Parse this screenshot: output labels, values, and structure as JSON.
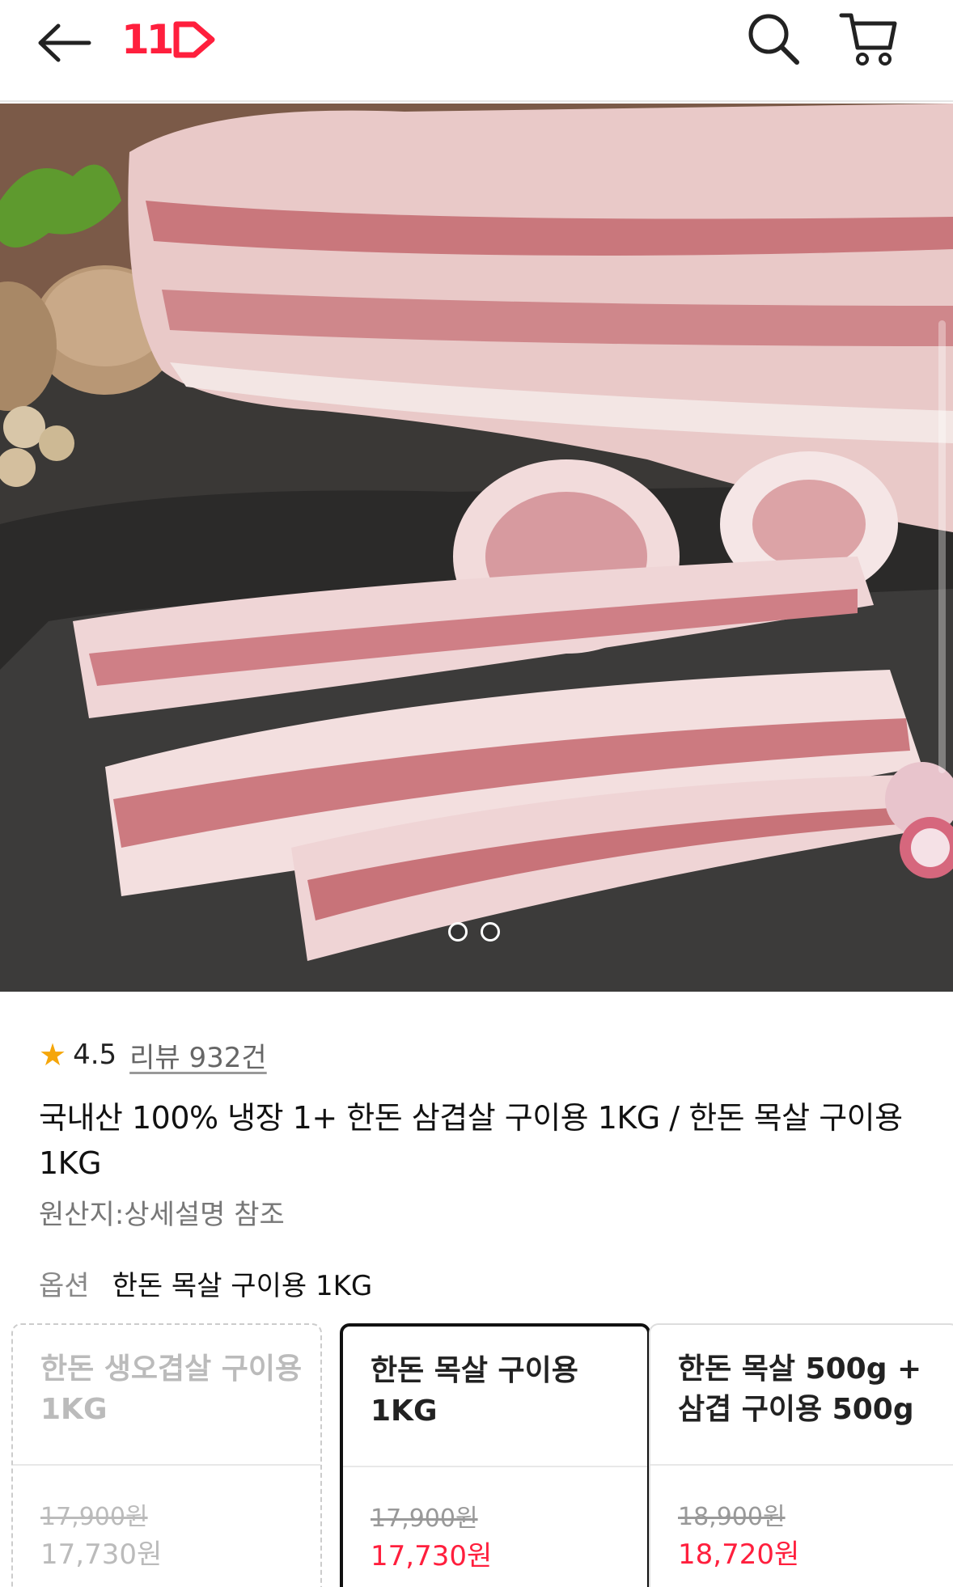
{
  "header": {
    "logo_text": "11",
    "brand_color": "#ff1f3d",
    "icons": [
      "back-arrow-icon",
      "search-icon",
      "cart-icon"
    ]
  },
  "gallery": {
    "total_images": 2,
    "current_index": 1
  },
  "product": {
    "rating": "4.5",
    "review_link": "리뷰 932건",
    "title": "국내산 100% 냉장 1+ 한돈 삼겹살 구이용 1KG / 한돈 목살 구이용 1KG",
    "origin": "원산지:상세설명 참조"
  },
  "option": {
    "label": "옵션",
    "selected_value": "한돈 목살 구이용 1KG"
  },
  "option_cards": [
    {
      "name": "한돈 생오겹살 구이용 1KG",
      "original_price": "17,900원",
      "sale_price": "17,730원",
      "state": "disabled"
    },
    {
      "name": "한돈 목살 구이용 1KG",
      "original_price": "17,900원",
      "sale_price": "17,730원",
      "state": "selected"
    },
    {
      "name": "한돈 목살 500g + 삼겹 구이용 500g",
      "original_price": "18,900원",
      "sale_price": "18,720원",
      "state": "normal"
    }
  ],
  "colors": {
    "accent": "#ff1f3d",
    "star": "#f5a60a"
  }
}
